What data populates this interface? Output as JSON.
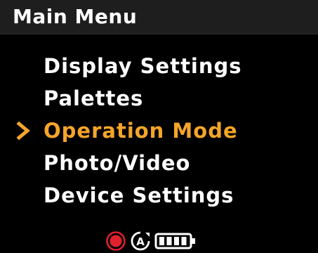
{
  "header": {
    "title": "Main Menu"
  },
  "menu": {
    "selected_index": 2,
    "items": [
      {
        "label": "Display Settings"
      },
      {
        "label": "Palettes"
      },
      {
        "label": "Operation Mode"
      },
      {
        "label": "Photo/Video"
      },
      {
        "label": "Device Settings"
      }
    ]
  },
  "status_bar": {
    "icons": [
      "record-icon",
      "auto-mode-icon",
      "battery-icon"
    ],
    "battery_level": 1.0,
    "auto_mode_letter": "A"
  },
  "colors": {
    "background": "#000000",
    "title_bar": "#1e1e1e",
    "text": "#ffffff",
    "selected": "#f5a52a",
    "record": "#e0202c"
  }
}
